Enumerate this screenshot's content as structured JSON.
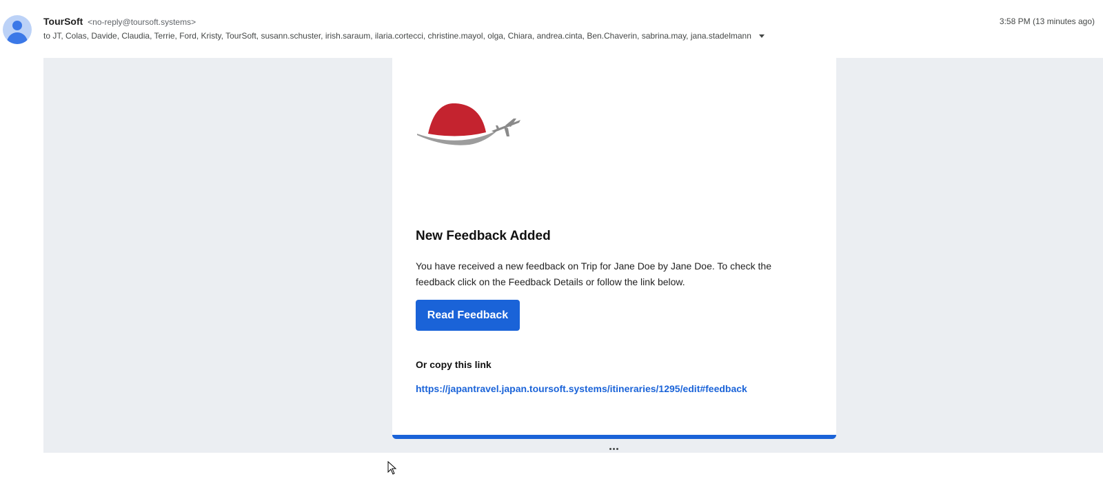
{
  "header": {
    "sender_name": "TourSoft",
    "sender_email": "<no-reply@toursoft.systems>",
    "recipients": "to JT, Colas, Davide, Claudia, Terrie, Ford, Kristy, TourSoft, susann.schuster, irish.saraum, ilaria.cortecci, christine.mayol, olga, Chiara, andrea.cinta, Ben.Chaverin, sabrina.may, jana.stadelmann",
    "timestamp": "3:58 PM (13 minutes ago)"
  },
  "email": {
    "title": "New Feedback Added",
    "body": "You have received a new feedback on Trip for Jane Doe by Jane Doe. To check the feedback click on the Feedback Details or follow the link below.",
    "button_label": "Read Feedback",
    "copy_label": "Or copy this link",
    "link": "https://japantravel.japan.toursoft.systems/itineraries/1295/edit#feedback"
  },
  "icons": {
    "avatar": "person-avatar-icon",
    "logo": "red-sun-airplane-logo",
    "recipients_toggle": "caret-down-icon",
    "more": "ellipsis-icon"
  },
  "colors": {
    "accent_blue": "#1a63d8",
    "logo_red": "#c4232f",
    "email_bg": "#ebeef2"
  }
}
